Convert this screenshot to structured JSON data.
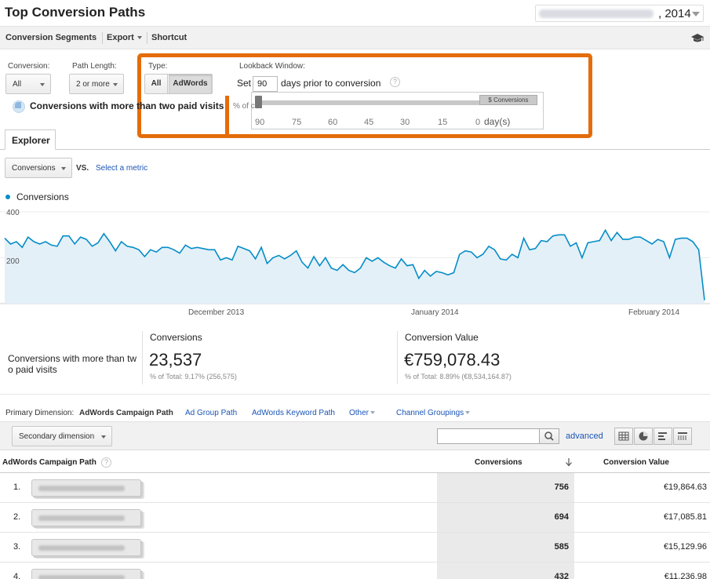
{
  "title": "Top Conversion Paths",
  "date_range": {
    "year_suffix": ", 2014"
  },
  "toolbar": {
    "conversion_segments": "Conversion Segments",
    "export": "Export",
    "shortcut": "Shortcut"
  },
  "filters": {
    "conversion_label": "Conversion:",
    "conversion_value": "All",
    "path_length_label": "Path Length:",
    "path_length_value": "2 or more",
    "type_label": "Type:",
    "type_all": "All",
    "type_adwords": "AdWords",
    "lookback_label": "Lookback Window:",
    "set_label": "Set",
    "set_value": "90",
    "days_prior": "days prior to conversion",
    "help": "?",
    "slider_conversions_label": "$ Conversions",
    "slider_ticks": [
      "90",
      "75",
      "60",
      "45",
      "30",
      "15",
      "0"
    ],
    "slider_unit": "day(s)"
  },
  "segment": {
    "text": "Conversions with more than two paid visits",
    "trail": "% of co"
  },
  "explorer": {
    "tab": "Explorer",
    "metric": "Conversions",
    "vs": "VS.",
    "select_metric": "Select a metric",
    "legend": "Conversions"
  },
  "chart_data": {
    "type": "area",
    "ylim": [
      0,
      400
    ],
    "y_ticks": [
      "400",
      "200"
    ],
    "x_labels": [
      "December 2013",
      "January 2014",
      "February 2014"
    ],
    "color": "#058dc7",
    "fill": "#e3f0f8",
    "values": [
      285,
      260,
      270,
      245,
      290,
      270,
      260,
      270,
      255,
      250,
      295,
      295,
      260,
      290,
      280,
      250,
      265,
      305,
      270,
      230,
      270,
      250,
      245,
      235,
      205,
      235,
      225,
      245,
      245,
      235,
      220,
      255,
      240,
      245,
      240,
      235,
      235,
      190,
      200,
      190,
      250,
      240,
      230,
      195,
      245,
      175,
      200,
      210,
      195,
      210,
      230,
      180,
      155,
      205,
      165,
      200,
      155,
      145,
      170,
      145,
      135,
      155,
      200,
      185,
      200,
      180,
      165,
      155,
      195,
      165,
      170,
      110,
      145,
      120,
      140,
      135,
      125,
      135,
      215,
      230,
      225,
      200,
      215,
      250,
      235,
      195,
      190,
      215,
      200,
      285,
      235,
      240,
      275,
      270,
      295,
      300,
      300,
      250,
      265,
      200,
      265,
      270,
      275,
      320,
      275,
      310,
      280,
      280,
      290,
      290,
      275,
      260,
      280,
      270,
      200,
      280,
      285,
      285,
      270,
      235,
      15
    ]
  },
  "summary": {
    "label": "Conversions with more than two paid visits",
    "conversions": {
      "title": "Conversions",
      "value": "23,537",
      "total": "% of Total: 9.17% (256,575)"
    },
    "conversion_value": {
      "title": "Conversion Value",
      "value": "€759,078.43",
      "total": "% of Total: 8.89% (€8,534,164.87)"
    }
  },
  "primary_dimension": {
    "label": "Primary Dimension:",
    "active": "AdWords Campaign Path",
    "links": [
      "Ad Group Path",
      "AdWords Keyword Path",
      "Other",
      "Channel Groupings"
    ]
  },
  "controls": {
    "secondary_dimension": "Secondary dimension",
    "advanced": "advanced"
  },
  "table": {
    "columns": {
      "path": "AdWords Campaign Path",
      "conversions": "Conversions",
      "value": "Conversion Value"
    },
    "rows": [
      {
        "num": "1.",
        "conversions": "756",
        "value": "€19,864.63"
      },
      {
        "num": "2.",
        "conversions": "694",
        "value": "€17,085.81"
      },
      {
        "num": "3.",
        "conversions": "585",
        "value": "€15,129.96"
      },
      {
        "num": "4.",
        "conversions": "432",
        "value": "€11,236.98"
      }
    ]
  }
}
